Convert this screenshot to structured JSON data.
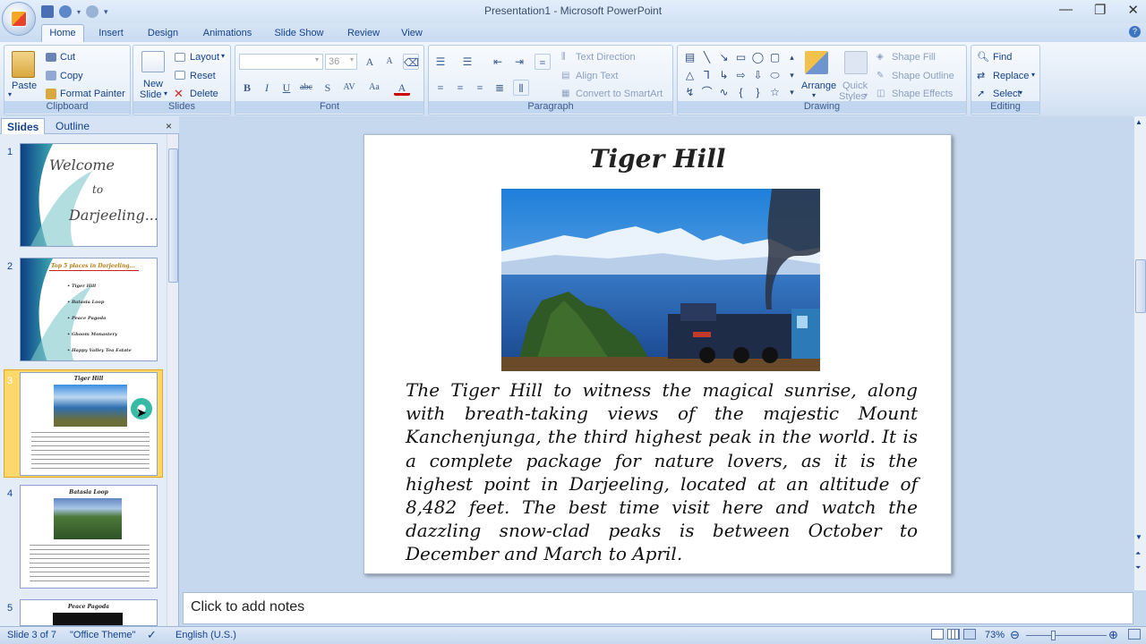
{
  "window": {
    "title": "Presentation1 - Microsoft PowerPoint",
    "minimize": "—",
    "restore": "❐",
    "close": "✕"
  },
  "tabs": [
    "Home",
    "Insert",
    "Design",
    "Animations",
    "Slide Show",
    "Review",
    "View"
  ],
  "ribbon": {
    "clipboard": {
      "label": "Clipboard",
      "paste": "Paste",
      "cut": "Cut",
      "copy": "Copy",
      "format_painter": "Format Painter"
    },
    "slides": {
      "label": "Slides",
      "new_slide_1": "New",
      "new_slide_2": "Slide",
      "layout": "Layout",
      "reset": "Reset",
      "delete": "Delete"
    },
    "font": {
      "label": "Font",
      "font_name": "",
      "font_size": "36"
    },
    "paragraph": {
      "label": "Paragraph",
      "text_direction": "Text Direction",
      "align_text": "Align Text",
      "convert_smartart": "Convert to SmartArt"
    },
    "drawing": {
      "label": "Drawing",
      "arrange": "Arrange",
      "quick_styles_1": "Quick",
      "quick_styles_2": "Styles",
      "shape_fill": "Shape Fill",
      "shape_outline": "Shape Outline",
      "shape_effects": "Shape Effects"
    },
    "editing": {
      "label": "Editing",
      "find": "Find",
      "replace": "Replace",
      "select": "Select"
    }
  },
  "pane": {
    "tab_slides": "Slides",
    "tab_outline": "Outline",
    "close": "×",
    "thumbnails": [
      {
        "num": "1",
        "title_lines": [
          "Welcome",
          "to",
          "Darjeeling..."
        ]
      },
      {
        "num": "2",
        "title": "Top 5 places in Darjeeling...",
        "bullets": [
          "Tiger Hill",
          "Batasia Loop",
          "Peace Pagoda",
          "Ghoom Monastery",
          "Happy Valley Tea Estate"
        ]
      },
      {
        "num": "3",
        "title": "Tiger Hill"
      },
      {
        "num": "4",
        "title": "Batasia Loop"
      },
      {
        "num": "5",
        "title": "Peace Pagoda"
      }
    ]
  },
  "slide": {
    "title": "Tiger Hill",
    "body": "The Tiger Hill to witness the magical sunrise, along with breath-taking views of the majestic Mount Kanchenjunga, the third highest peak in the world. It is a complete package for nature lovers, as it is the highest point in Darjeeling, located at an altitude of 8,482 feet. The best time visit here and watch the dazzling snow-clad peaks is between October to December and March to April."
  },
  "notes": {
    "placeholder": "Click to add notes"
  },
  "status": {
    "slide_counter": "Slide 3 of 7",
    "theme": "\"Office Theme\"",
    "language": "English (U.S.)",
    "zoom": "73%"
  }
}
